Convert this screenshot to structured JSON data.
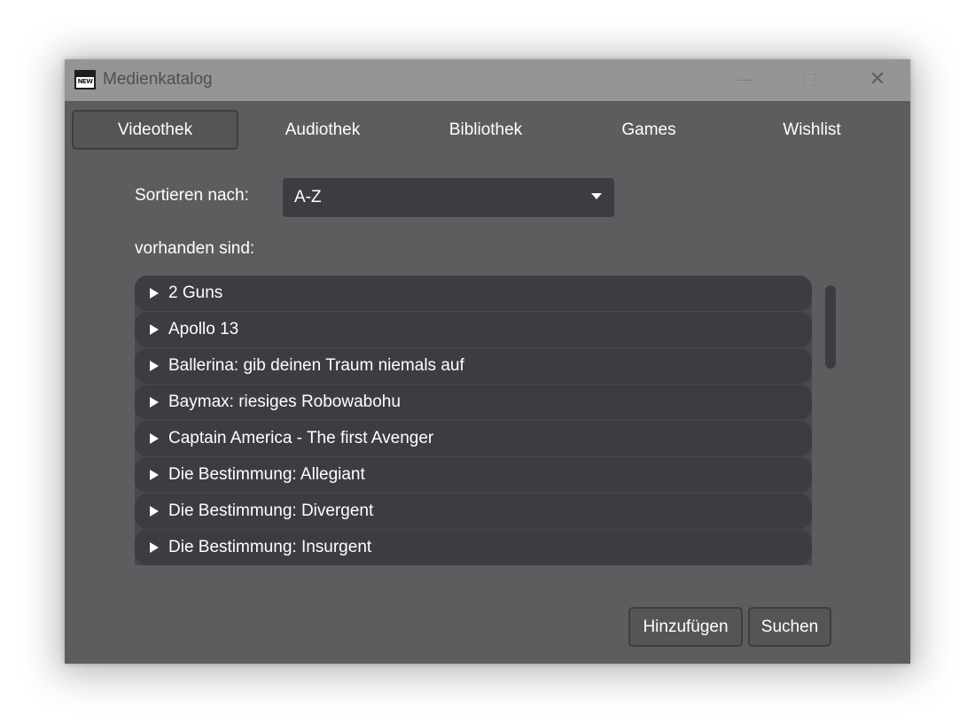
{
  "window": {
    "title": "Medienkatalog",
    "icon": "app-icon"
  },
  "tabs": [
    {
      "label": "Videothek",
      "active": true
    },
    {
      "label": "Audiothek",
      "active": false
    },
    {
      "label": "Bibliothek",
      "active": false
    },
    {
      "label": "Games",
      "active": false
    },
    {
      "label": "Wishlist",
      "active": false
    }
  ],
  "sort": {
    "label": "Sortieren nach:",
    "value": "A-Z"
  },
  "available_label": "vorhanden sind:",
  "items": [
    "2 Guns",
    "Apollo 13",
    "Ballerina: gib deinen Traum niemals auf",
    "Baymax: riesiges Robowabohu",
    "Captain America - The first Avenger",
    "Die Bestimmung: Allegiant",
    "Die Bestimmung: Divergent",
    "Die Bestimmung: Insurgent"
  ],
  "buttons": {
    "add": "Hinzufügen",
    "search": "Suchen"
  },
  "colors": {
    "window_bg": "#5d5c5e",
    "titlebar_bg": "#959496",
    "item_bg": "#3e3c40",
    "text": "#ffffff"
  }
}
